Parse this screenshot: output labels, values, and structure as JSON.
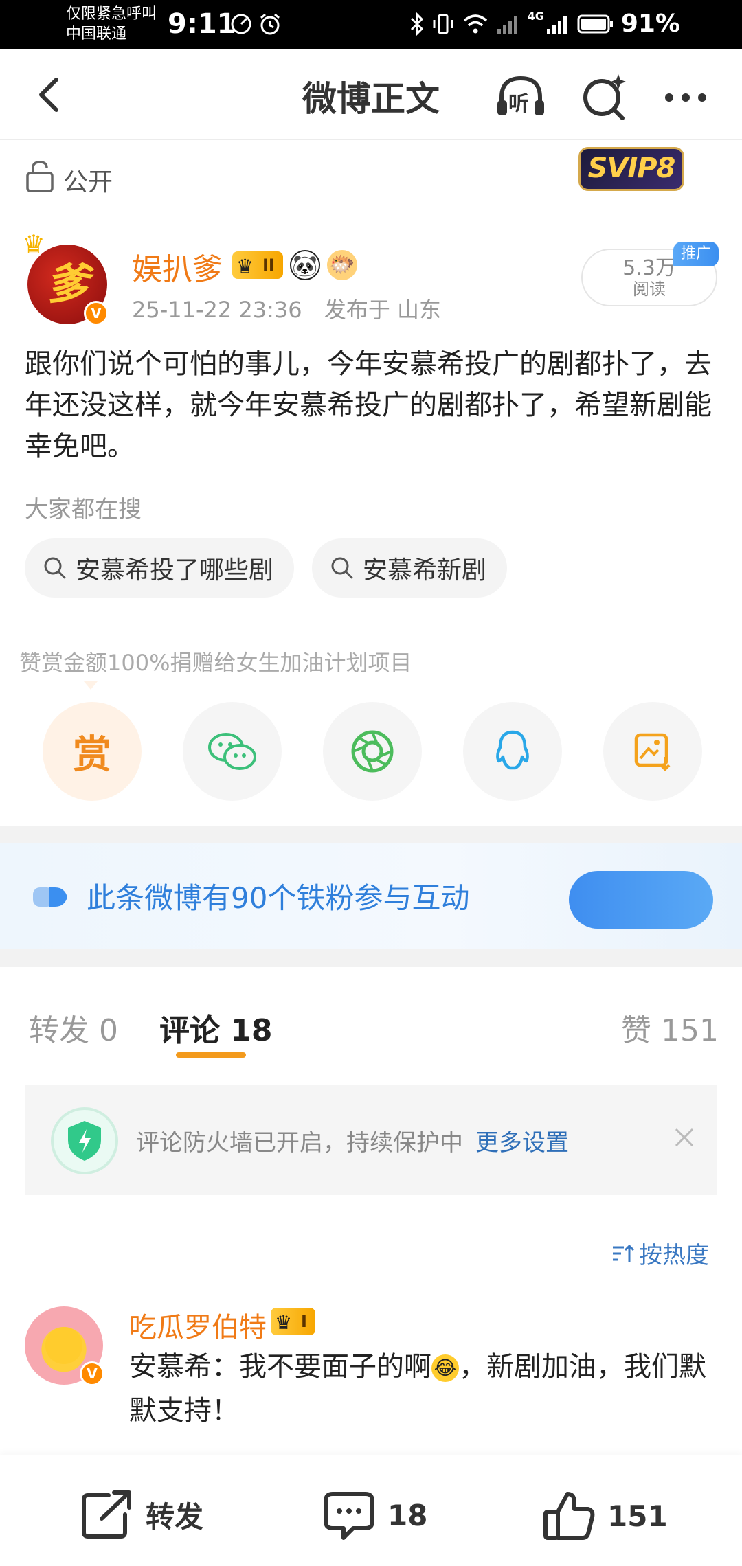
{
  "status_bar": {
    "carrier_line1": "仅限紧急呼叫",
    "carrier_line2": "中国联通",
    "time": "9:11",
    "network": "4G",
    "battery": "91%"
  },
  "nav": {
    "title": "微博正文",
    "listen_label": "听"
  },
  "visibility": {
    "label": "公开",
    "svip_badge": "SVIP8"
  },
  "author": {
    "name": "娱扒爹",
    "avatar_char": "爹",
    "level": "II",
    "timestamp": "25-11-22 23:36",
    "location": "发布于 山东",
    "read_count": "5.3万",
    "read_label": "阅读",
    "promo_tag": "推广"
  },
  "post": {
    "text": "跟你们说个可怕的事儿，今年安慕希投广的剧都扑了，去年还没这样，就今年安慕希投广的剧都扑了，希望新剧能幸免吧。",
    "search_hint": "大家都在搜",
    "search_chips": [
      "安慕希投了哪些剧",
      "安慕希新剧"
    ]
  },
  "reward": {
    "text": "赞赏金额100%捐赠给女生加油计划项目",
    "reward_char": "赏"
  },
  "fans_banner": {
    "text": "此条微博有90个铁粉参与互动"
  },
  "tabs": {
    "repost": "转发 0",
    "comments": "评论 18",
    "likes": "赞 151"
  },
  "firewall": {
    "text": "评论防火墙已开启，持续保护中",
    "link": "更多设置"
  },
  "sort": {
    "label": "按热度"
  },
  "comment": {
    "name": "吃瓜罗伯特",
    "level": "I",
    "text_part1": "安慕希：我不要面子的啊",
    "text_part2": "，新剧加油，我们默默支持！"
  },
  "bottom_bar": {
    "repost_label": "转发",
    "comment_count": "18",
    "like_count": "151"
  },
  "colors": {
    "accent_orange": "#f07a16",
    "link_blue": "#2f7fdb",
    "tab_underline": "#f39a1c"
  }
}
